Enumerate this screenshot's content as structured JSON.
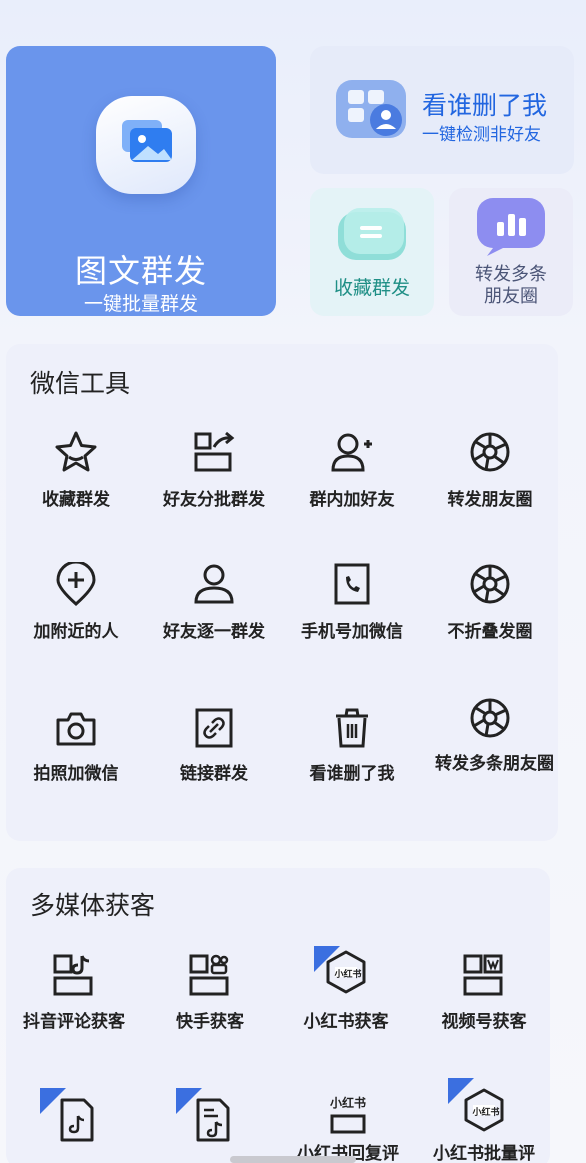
{
  "hero": {
    "main": {
      "title": "图文群发",
      "subtitle": "一键批量群发",
      "icon": "image-gallery-icon"
    },
    "who_deleted": {
      "title": "看谁删了我",
      "subtitle": "一键检测非好友",
      "icon": "contacts-grid-icon"
    },
    "favorites": {
      "label": "收藏群发",
      "icon": "message-bubble-icon"
    },
    "forward": {
      "line1": "转发多条",
      "line2": "朋友圈",
      "icon": "chart-bubble-icon"
    }
  },
  "wechat_tools": {
    "title": "微信工具",
    "items": [
      {
        "label": "收藏群发",
        "icon": "star-icon"
      },
      {
        "label": "好友分批群发",
        "icon": "batch-forward-icon"
      },
      {
        "label": "群内加好友",
        "icon": "add-user-icon"
      },
      {
        "label": "转发朋友圈",
        "icon": "aperture-icon"
      },
      {
        "label": "加附近的人",
        "icon": "location-add-icon"
      },
      {
        "label": "好友逐一群发",
        "icon": "user-icon"
      },
      {
        "label": "手机号加微信",
        "icon": "phone-icon"
      },
      {
        "label": "不折叠发圈",
        "icon": "aperture-icon"
      },
      {
        "label": "拍照加微信",
        "icon": "camera-icon"
      },
      {
        "label": "链接群发",
        "icon": "link-icon"
      },
      {
        "label": "看谁删了我",
        "icon": "trash-icon"
      },
      {
        "label": "转发多条朋友圈",
        "icon": "aperture-icon"
      }
    ]
  },
  "multimedia": {
    "title": "多媒体获客",
    "items": [
      {
        "label": "抖音评论获客",
        "icon": "douyin-icon"
      },
      {
        "label": "快手获客",
        "icon": "kuaishou-icon"
      },
      {
        "label": "小红书获客",
        "icon": "xiaohongshu-icon",
        "badge_text": "小红书"
      },
      {
        "label": "视频号获客",
        "icon": "video-channel-icon"
      },
      {
        "label": "",
        "icon": "douyin-doc-icon"
      },
      {
        "label": "",
        "icon": "douyin-file-icon"
      },
      {
        "label": "小红书回复评",
        "icon": "xiaohongshu-reply-icon",
        "badge_text": "小红书"
      },
      {
        "label": "小红书批量评",
        "icon": "xiaohongshu-batch-icon",
        "badge_text": "小红书"
      }
    ]
  },
  "colors": {
    "primary": "#6a95ec",
    "accent_blue": "#2266e0",
    "teal": "#1f8f86",
    "badge": "#3b6fe0"
  }
}
